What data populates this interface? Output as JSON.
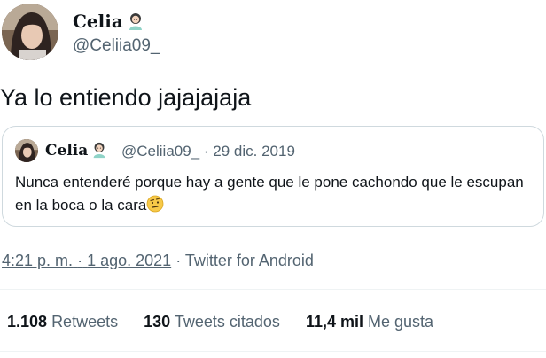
{
  "author": {
    "display_name": "Celia",
    "handle": "@Celiia09_"
  },
  "tweet": {
    "text": "Ya lo entiendo jajajajaja"
  },
  "quoted_tweet": {
    "display_name": "Celia",
    "handle": "@Celiia09_",
    "separator": "·",
    "date": "29 dic. 2019",
    "text": "Nunca entenderé porque hay a gente que le pone cachondo que le escupan en la boca o la cara"
  },
  "meta": {
    "time": "4:21 p. m.",
    "separator1": "·",
    "date": "1 ago. 2021",
    "separator2": "·",
    "source": "Twitter for Android"
  },
  "stats": {
    "retweets_count": "1.108",
    "retweets_label": "Retweets",
    "quotes_count": "130",
    "quotes_label": "Tweets citados",
    "likes_count": "11,4 mil",
    "likes_label": "Me gusta"
  },
  "colors": {
    "text": "#0f1419",
    "secondary": "#536471",
    "border": "#cfd9de"
  }
}
